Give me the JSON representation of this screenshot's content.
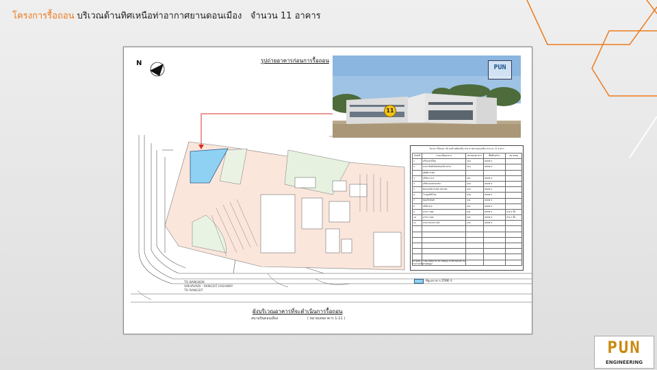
{
  "title": {
    "project": "โครงการรื้อถอน",
    "location": "บริเวณด้านทิศเหนือท่าอากาศยานดอนเมือง",
    "count": "จำนวน 11 อาคาร"
  },
  "sheet": {
    "photo_caption": "รูปถ่ายอาคารก่อนการรื้อถอน",
    "photo_logo": "PUN",
    "building_badge": "11",
    "north_label": "N",
    "legend_title": "โครงการรื้อถอน บริเวณด้านทิศเหนือ ท่าอากาศยานดอนเมือง จำนวน 11 อาคาร",
    "legend_headers": [
      "ลำดับที่",
      "รายละเอียดอาคาร",
      "หมายเลขอาคาร",
      "พื้นที่ก่อสร้าง",
      "หมายเหตุ"
    ],
    "legend_rows": [
      [
        "1",
        "หรือรองรับใหม่",
        "164",
        "ZONE 4",
        ""
      ],
      [
        "2",
        "อาคารสินค้าทัณฑ์บน/วิศวกรรม",
        "404",
        "ZONE 4",
        ""
      ],
      [
        "",
        "ผลิตสิ่ง ท่าอ้อ",
        "",
        "",
        ""
      ],
      [
        "3",
        "บริษัท ก.ส.ท",
        "161",
        "ZONE 4",
        ""
      ],
      [
        "4",
        "บริษัท อยกดำมนริยา",
        "443",
        "ZONE 4",
        ""
      ],
      [
        "5",
        "BOOSTER PUMP HOUSE",
        "443",
        "ZONE 4",
        ""
      ],
      [
        "6",
        "โรงปูนไม้นิโลย",
        "436",
        "ZONE 4",
        ""
      ],
      [
        "7",
        "ห้องเก็บสินค้า",
        "441",
        "ZONE 4",
        ""
      ],
      [
        "8",
        "บริษัท ช.ช.",
        "441",
        "ZONE 4",
        ""
      ],
      [
        "9",
        "อาคาร ดอด",
        "441",
        "ZONE 4",
        "ส่วน 4 ชั้น"
      ],
      [
        "10",
        "อาคาร ดอด",
        "441",
        "ZONE 4",
        "ส่วน 7 ชั้น"
      ],
      [
        "11",
        "อาคารสถานกระทิง",
        "135",
        "ZONE 4",
        ""
      ],
      [
        "",
        "",
        "",
        "",
        ""
      ],
      [
        "",
        "",
        "",
        "",
        ""
      ],
      [
        "",
        "",
        "",
        "",
        ""
      ],
      [
        "",
        "",
        "",
        "",
        ""
      ],
      [
        "",
        "",
        "",
        "",
        ""
      ],
      [
        "",
        "",
        "",
        "",
        ""
      ],
      [
        "",
        "",
        "",
        "",
        ""
      ]
    ],
    "legend_note_1": "หมายเหตุ : รายละเอียดอาคารตามสัญญา ดังนี้ตามผังบริเวณ",
    "legend_note_2": "ตามรายการตามสัญญา",
    "zone_key": "ที่ดูแลอาคาร ZONE 4",
    "map_caption": "ผังบริเวณอาคารที่จะดำเนินการรื้อถอน",
    "map_sub_left": "สนามบินดอนเมือง",
    "map_sub_right": "( หมายเลขอาคาร 1-11 )",
    "road_1": "TO BANGKOK",
    "road_2": "VIBHAVADI - RANGSIT HIGHWAY",
    "road_3": "TO RANGSIT"
  },
  "logo": {
    "main": "PUN",
    "sub": "ENGINEERING"
  },
  "colors": {
    "accent": "#ec7a1c",
    "zone_highlight": "#8fd1f2",
    "marker_line": "#d9302a"
  }
}
